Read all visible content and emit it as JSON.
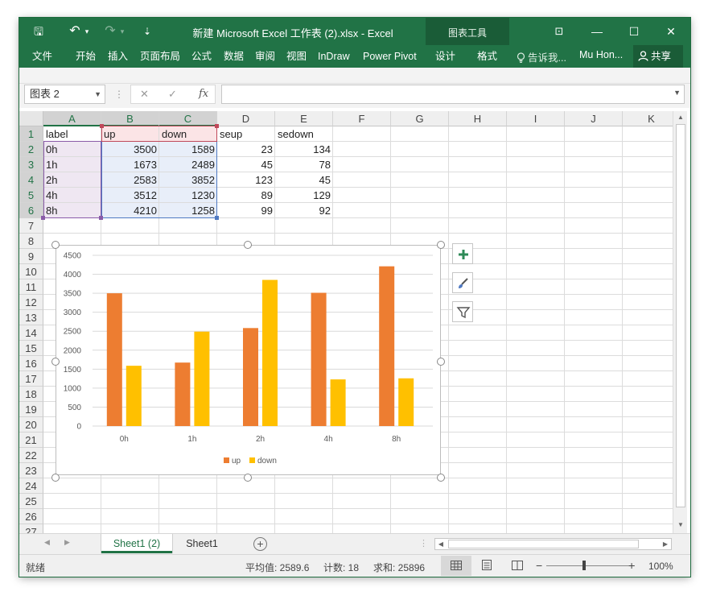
{
  "window": {
    "title": "新建 Microsoft Excel 工作表 (2).xlsx - Excel",
    "chart_tools_label": "图表工具",
    "controls": {
      "ribbon_display": "⊡",
      "minimize": "—",
      "maximize": "☐",
      "close": "✕"
    }
  },
  "qat": {
    "save": "🖫",
    "undo": "↶",
    "undo_drop": "▾",
    "redo": "↷",
    "redo_drop": "▾",
    "customize": "⇣"
  },
  "ribbon": {
    "tabs": [
      "文件",
      "开始",
      "插入",
      "页面布局",
      "公式",
      "数据",
      "审阅",
      "视图",
      "InDraw",
      "Power Pivot",
      "设计",
      "格式"
    ],
    "tell_me": "告诉我...",
    "user": "Mu Hon...",
    "share": "共享"
  },
  "formula_bar": {
    "name_box": "图表 2",
    "formula": "",
    "fx": "fx",
    "cancel": "✕",
    "enter": "✓",
    "dots": "⋮"
  },
  "columns": [
    "A",
    "B",
    "C",
    "D",
    "E",
    "F",
    "G",
    "H",
    "I",
    "J",
    "K"
  ],
  "rows": [
    "1",
    "2",
    "3",
    "4",
    "5",
    "6",
    "7",
    "8",
    "9",
    "10",
    "11",
    "12",
    "13",
    "14",
    "15",
    "16",
    "17",
    "18",
    "19",
    "20",
    "21",
    "22",
    "23",
    "24",
    "25",
    "26",
    "27"
  ],
  "sheet": {
    "headers": [
      "label",
      "up",
      "down",
      "seup",
      "sedown"
    ],
    "data": [
      [
        "0h",
        "3500",
        "1589",
        "23",
        "134"
      ],
      [
        "1h",
        "1673",
        "2489",
        "45",
        "78"
      ],
      [
        "2h",
        "2583",
        "3852",
        "123",
        "45"
      ],
      [
        "4h",
        "3512",
        "1230",
        "89",
        "129"
      ],
      [
        "8h",
        "4210",
        "1258",
        "99",
        "92"
      ]
    ]
  },
  "chart_data": {
    "type": "bar",
    "title": "",
    "xlabel": "",
    "ylabel": "",
    "categories": [
      "0h",
      "1h",
      "2h",
      "4h",
      "8h"
    ],
    "series": [
      {
        "name": "up",
        "values": [
          3500,
          1673,
          2583,
          3512,
          4210
        ],
        "color": "#ED7D31"
      },
      {
        "name": "down",
        "values": [
          1589,
          2489,
          3852,
          1230,
          1258
        ],
        "color": "#FFC000"
      }
    ],
    "ylim": [
      0,
      4500
    ],
    "yticks": [
      "0",
      "500",
      "1000",
      "1500",
      "2000",
      "2500",
      "3000",
      "3500",
      "4000",
      "4500"
    ],
    "grid": true,
    "legend": "bottom"
  },
  "chart_side_buttons": {
    "elements": "+",
    "styles": "🖌",
    "filter": "⏚"
  },
  "sheet_tabs": {
    "tabs": [
      "Sheet1 (2)",
      "Sheet1"
    ],
    "active": 0,
    "add": "+"
  },
  "status": {
    "ready": "就绪",
    "average": "平均值: 2589.6",
    "count": "计数: 18",
    "sum": "求和: 25896",
    "zoom": "100%",
    "zoom_minus": "−",
    "zoom_plus": "+"
  },
  "colors": {
    "brand": "#217346",
    "up": "#ED7D31",
    "down": "#FFC000"
  }
}
